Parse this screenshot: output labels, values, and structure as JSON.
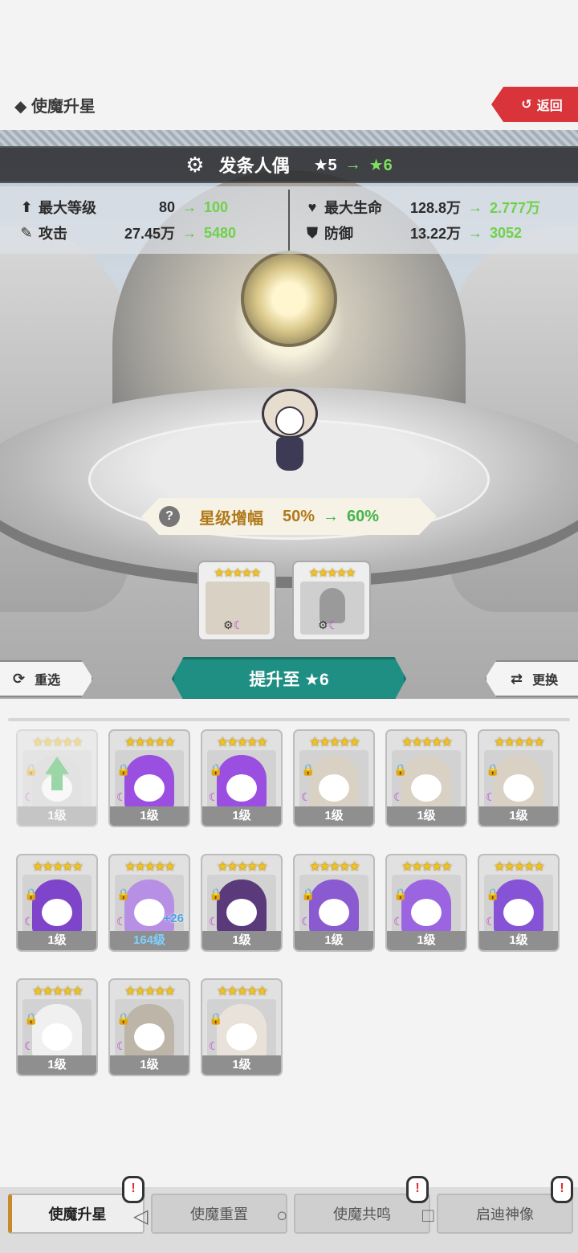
{
  "header": {
    "title": "◆ 使魔升星",
    "back_label": "返回",
    "back_icon": "return-arrow-icon"
  },
  "hero": {
    "name": "发条人偶",
    "star_from": "★5",
    "arrow": "→",
    "star_to": "★6"
  },
  "stats": [
    {
      "icon": "⬆",
      "label": "最大等级",
      "from": "80",
      "to": "100"
    },
    {
      "icon": "♥",
      "label": "最大生命",
      "from": "128.8万",
      "to": "2.777万"
    },
    {
      "icon": "✎",
      "label": "攻击",
      "from": "27.45万",
      "to": "5480"
    },
    {
      "icon": "⛊",
      "label": "防御",
      "from": "13.22万",
      "to": "3052"
    }
  ],
  "amplify": {
    "label": "星级增幅",
    "from": "50%",
    "to": "60%",
    "help": "?"
  },
  "slots": [
    {
      "stars": "★★★★★",
      "type": "hero"
    },
    {
      "stars": "★★★★★",
      "type": "placeholder"
    }
  ],
  "actions": {
    "reselect": "重选",
    "upgrade": "提升至 ★6",
    "swap": "更换"
  },
  "inventory": [
    {
      "stars": "★★★★★",
      "level": "1级",
      "hair": "#cfcfcf",
      "faded": true,
      "up": true
    },
    {
      "stars": "★★★★★",
      "level": "1级",
      "hair": "#9a4fe0"
    },
    {
      "stars": "★★★★★",
      "level": "1级",
      "hair": "#9a4fe0"
    },
    {
      "stars": "★★★★★",
      "level": "1级",
      "hair": "#d9d1c3"
    },
    {
      "stars": "★★★★★",
      "level": "1级",
      "hair": "#d9d1c3"
    },
    {
      "stars": "★★★★★",
      "level": "1级",
      "hair": "#d9d1c3"
    },
    {
      "stars": "★★★★★",
      "level": "1级",
      "hair": "#7e44c9"
    },
    {
      "stars": "★★★★★",
      "level": "164级",
      "hair": "#b790e6",
      "plus": "+26",
      "hi": true
    },
    {
      "stars": "★★★★★",
      "level": "1级",
      "hair": "#5a3a7a"
    },
    {
      "stars": "★★★★★",
      "level": "1级",
      "hair": "#8a5ad0"
    },
    {
      "stars": "★★★★★",
      "level": "1级",
      "hair": "#9b64e0"
    },
    {
      "stars": "★★★★★",
      "level": "1级",
      "hair": "#8652d6"
    },
    {
      "stars": "★★★★★",
      "level": "1级",
      "hair": "#f0f0f0"
    },
    {
      "stars": "★★★★★",
      "level": "1级",
      "hair": "#bdb6a8"
    },
    {
      "stars": "★★★★★",
      "level": "1级",
      "hair": "#e8e2da"
    }
  ],
  "tabs": [
    "使魔升星",
    "使魔重置",
    "使魔共鸣",
    "启迪神像"
  ],
  "alerts": [
    "!",
    "!",
    "!"
  ]
}
